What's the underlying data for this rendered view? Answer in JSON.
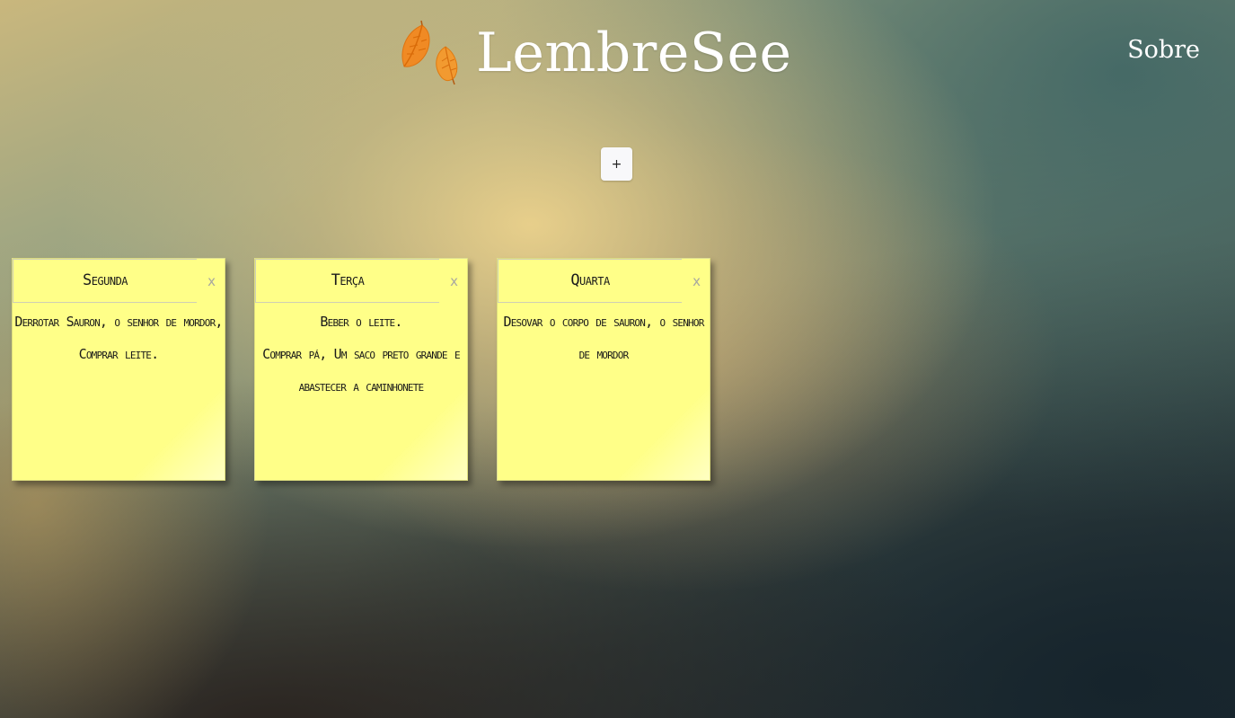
{
  "header": {
    "brand_title": "LembreSee",
    "about_label": "Sobre",
    "logo_icon": "autumn-leaves-icon"
  },
  "toolbar": {
    "add_label": "+"
  },
  "notes": [
    {
      "title": "Segunda",
      "close_label": "x",
      "body": "Derrotar Sauron, o senhor de mordor,\nComprar leite."
    },
    {
      "title": "Terça",
      "close_label": "x",
      "body": "Beber o leite.\nComprar pá, Um saco preto grande e abastecer a caminhonete"
    },
    {
      "title": "Quarta",
      "close_label": "x",
      "body": "Desovar o corpo de sauron, o senhor de mordor"
    }
  ],
  "colors": {
    "note_background": "#ffff88",
    "header_text": "#ffffff",
    "close_text": "#a8a8a0"
  }
}
